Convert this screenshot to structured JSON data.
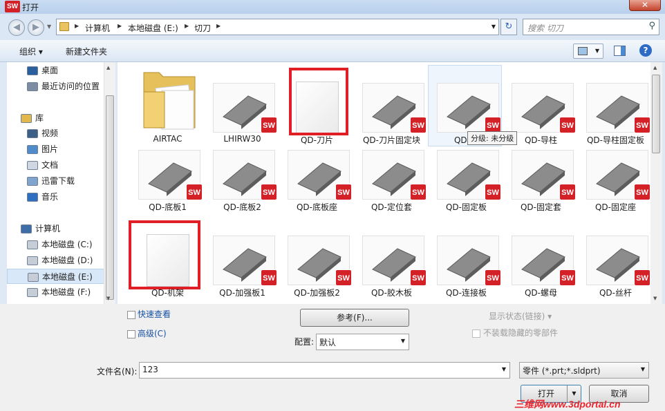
{
  "window": {
    "title": "打开",
    "app_logo": "SW",
    "close_symbol": "✕"
  },
  "nav_buttons": {
    "back": "◀",
    "forward": "▶"
  },
  "address": {
    "crumbs": [
      "计算机",
      "本地磁盘 (E:)",
      "切刀"
    ],
    "separator": "▶",
    "dropdown": "▼",
    "refresh": "↻",
    "search_placeholder": "搜索 切刀",
    "search_icon": "⚲"
  },
  "toolbar": {
    "organize_label": "组织 ▾",
    "new_folder_label": "新建文件夹",
    "help": "?"
  },
  "nav_pane": {
    "items": [
      {
        "label": "桌面",
        "icon": "desktop-icon",
        "color": "#2a5f9e"
      },
      {
        "label": "最近访问的位置",
        "icon": "recent-places-icon",
        "color": "#7c8da3"
      },
      {
        "label": "库",
        "icon": "library-icon",
        "color": "#e2b84d"
      },
      {
        "label": "视频",
        "icon": "video-icon",
        "color": "#3b5f86"
      },
      {
        "label": "图片",
        "icon": "pictures-icon",
        "color": "#4f8cc9"
      },
      {
        "label": "文档",
        "icon": "documents-icon",
        "color": "#cfd7e2"
      },
      {
        "label": "迅雷下载",
        "icon": "download-icon",
        "color": "#7fa5cf"
      },
      {
        "label": "音乐",
        "icon": "music-icon",
        "color": "#2f6fbf"
      },
      {
        "label": "计算机",
        "icon": "computer-icon",
        "color": "#3d6ea8"
      },
      {
        "label": "本地磁盘 (C:)",
        "icon": "drive-windows-icon",
        "color": "#c6cdd6"
      },
      {
        "label": "本地磁盘 (D:)",
        "icon": "drive-icon",
        "color": "#c6cdd6"
      },
      {
        "label": "本地磁盘 (E:)",
        "icon": "drive-icon",
        "color": "#c6cdd6",
        "selected": true
      },
      {
        "label": "本地磁盘 (F:)",
        "icon": "drive-icon",
        "color": "#c6cdd6"
      }
    ]
  },
  "files": {
    "sw_badge": "SW",
    "tooltip": "分级: 未分级",
    "items": [
      {
        "label": "AIRTAC",
        "kind": "folder"
      },
      {
        "label": "LHIRW30",
        "kind": "part"
      },
      {
        "label": "QD-刀片",
        "kind": "empty",
        "highlighted": true
      },
      {
        "label": "QD-刀片固定块",
        "kind": "part"
      },
      {
        "label": "QD-刀",
        "kind": "part",
        "hovered": true
      },
      {
        "label": "QD-导柱",
        "kind": "part"
      },
      {
        "label": "QD-导柱固定板",
        "kind": "part"
      },
      {
        "label": "QD-底板1",
        "kind": "part"
      },
      {
        "label": "QD-底板2",
        "kind": "part"
      },
      {
        "label": "QD-底板座",
        "kind": "part"
      },
      {
        "label": "QD-定位套",
        "kind": "part"
      },
      {
        "label": "QD-固定板",
        "kind": "part"
      },
      {
        "label": "QD-固定套",
        "kind": "part"
      },
      {
        "label": "QD-固定座",
        "kind": "part"
      },
      {
        "label": "QD-机架",
        "kind": "empty",
        "highlighted": true
      },
      {
        "label": "QD-加强板1",
        "kind": "part"
      },
      {
        "label": "QD-加强板2",
        "kind": "part"
      },
      {
        "label": "QD-胶木板",
        "kind": "part"
      },
      {
        "label": "QD-连接板",
        "kind": "part"
      },
      {
        "label": "QD-螺母",
        "kind": "part"
      },
      {
        "label": "QD-丝杆",
        "kind": "part"
      }
    ]
  },
  "bottom": {
    "quick_view_label": "快速查看",
    "advanced_label": "高级(C)",
    "reference_button": "参考(F)...",
    "config_label": "配置:",
    "config_value": "默认",
    "display_state_label": "显示状态(链接) ▾",
    "no_hidden_parts_label": "不装载隐藏的零部件",
    "filename_label": "文件名(N):",
    "filename_value": "123",
    "filetype_value": "零件 (*.prt;*.sldprt)",
    "open_button": "打开",
    "cancel_button": "取消"
  },
  "watermark": "三维网www.3dportal.cn"
}
